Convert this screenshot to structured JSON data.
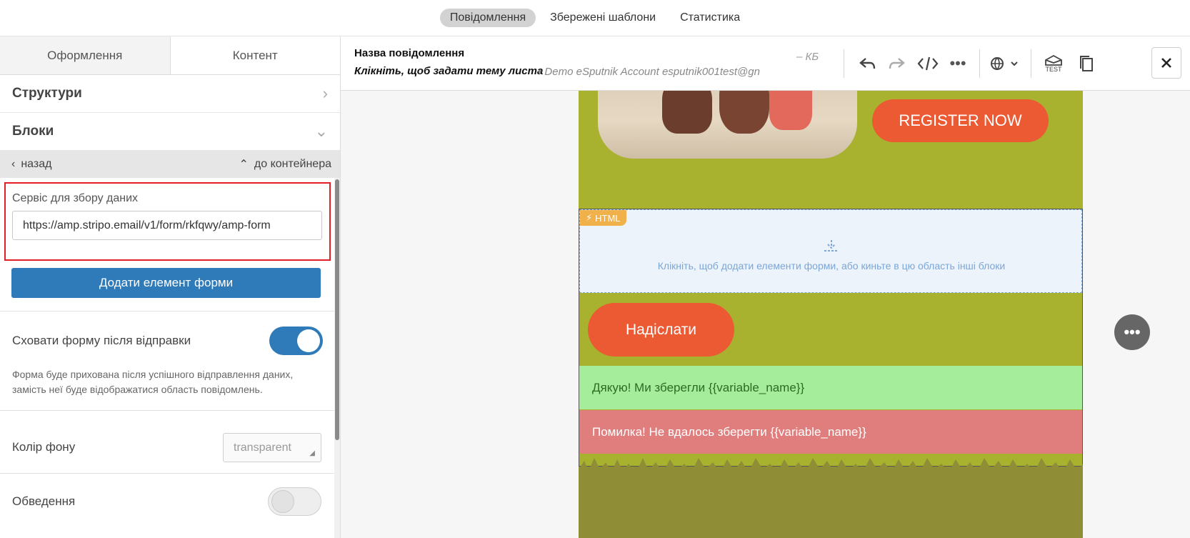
{
  "topnav": {
    "tabs": [
      "Повідомлення",
      "Збережені шаблони",
      "Статистика"
    ]
  },
  "left": {
    "tabs": [
      "Оформлення",
      "Контент"
    ],
    "structures": "Структури",
    "blocks": "Блоки",
    "back": "назад",
    "to_container": "до контейнера",
    "service_label": "Сервіс для збору даних",
    "service_value": "https://amp.stripo.email/v1/form/rkfqwy/amp-form",
    "add_button": "Додати елемент форми",
    "hide_label": "Сховати форму після відправки",
    "hide_hint": "Форма буде прихована після успішного відправлення даних, замість неї буде відображатися область повідомлень.",
    "bg_label": "Колір фону",
    "bg_value": "transparent",
    "border_label": "Обведення"
  },
  "header": {
    "name": "Назва повідомлення",
    "subject": "Клікніть, щоб задати тему листа",
    "sender": "• Demo eSputnik Account esputnik001test@gn",
    "size": "– КБ",
    "test_label": "TEST"
  },
  "canvas": {
    "register": "REGISTER NOW",
    "html_tag": "HTML",
    "drop_text": "Клікніть, щоб додати елементи форми, або киньте в цю область інші блоки",
    "send": "Надіслати",
    "success": "Дякую! Ми зберегли {{variable_name}}",
    "error": "Помилка! Не вдалось зберегти {{variable_name}}"
  },
  "colors": {
    "accent": "#2f7ab8",
    "brand_orange": "#ec5a33",
    "email_bg": "#a9b22f",
    "highlight": "#e21f26"
  }
}
